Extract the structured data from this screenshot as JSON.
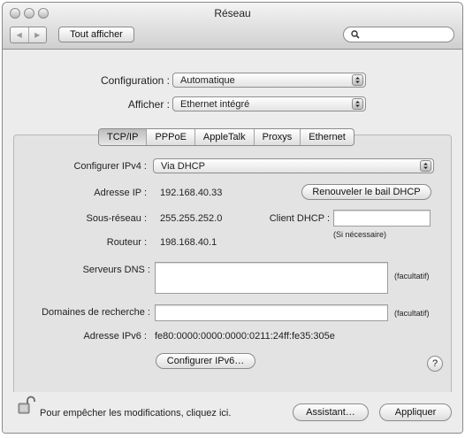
{
  "window": {
    "title": "Réseau"
  },
  "toolbar": {
    "back_label": "◀",
    "forward_label": "▶",
    "show_all_label": "Tout afficher",
    "search_placeholder": ""
  },
  "top": {
    "configuration_label": "Configuration :",
    "configuration_value": "Automatique",
    "show_label": "Afficher :",
    "show_value": "Ethernet intégré"
  },
  "tabs": [
    "TCP/IP",
    "PPPoE",
    "AppleTalk",
    "Proxys",
    "Ethernet"
  ],
  "selected_tab": "TCP/IP",
  "tcpip": {
    "configure_ipv4_label": "Configurer IPv4 :",
    "configure_ipv4_value": "Via DHCP",
    "ip_label": "Adresse IP :",
    "ip_value": "192.168.40.33",
    "renew_button": "Renouveler le bail DHCP",
    "subnet_label": "Sous-réseau :",
    "subnet_value": "255.255.252.0",
    "dhcp_client_label": "Client DHCP :",
    "dhcp_client_value": "",
    "dhcp_client_hint": "(Si nécessaire)",
    "router_label": "Routeur :",
    "router_value": "198.168.40.1",
    "dns_label": "Serveurs DNS :",
    "dns_value": "",
    "dns_hint": "(facultatif)",
    "search_domains_label": "Domaines de recherche :",
    "search_domains_value": "",
    "search_domains_hint": "(facultatif)",
    "ipv6_label": "Adresse IPv6 :",
    "ipv6_value": "fe80:0000:0000:0000:0211:24ff:fe35:305e",
    "configure_ipv6_button": "Configurer IPv6…",
    "help_label": "?"
  },
  "bottom": {
    "lock_text": "Pour empêcher les modifications, cliquez ici.",
    "assistant_button": "Assistant…",
    "apply_button": "Appliquer"
  },
  "icons": {
    "close": "close-icon",
    "minimize": "minimize-icon",
    "zoom": "zoom-icon",
    "search": "search-icon",
    "lock": "lock-icon",
    "popup": "chevron-updown-icon"
  }
}
